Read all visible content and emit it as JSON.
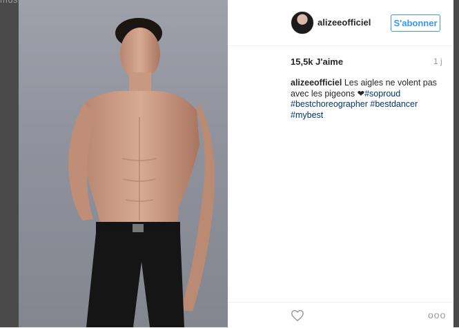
{
  "overlay": {
    "top_text": "musique"
  },
  "post": {
    "username": "alizeeofficiel",
    "follow_label": "S'abonner",
    "likes": "15,5k J'aime",
    "age": "1 j",
    "caption": {
      "username": "alizeeofficiel",
      "text": " Les aigles ne volent pas avec les pigeons ",
      "heart": "❤",
      "tags": [
        "#soproud",
        "#bestchoreographer",
        "#bestdancer",
        "#mybest"
      ]
    },
    "more_label": "ooo"
  },
  "colors": {
    "accent": "#3897f0",
    "hashtag": "#003569"
  },
  "icons": {
    "like": "heart-icon",
    "more": "more-options-icon",
    "avatar": "avatar"
  }
}
